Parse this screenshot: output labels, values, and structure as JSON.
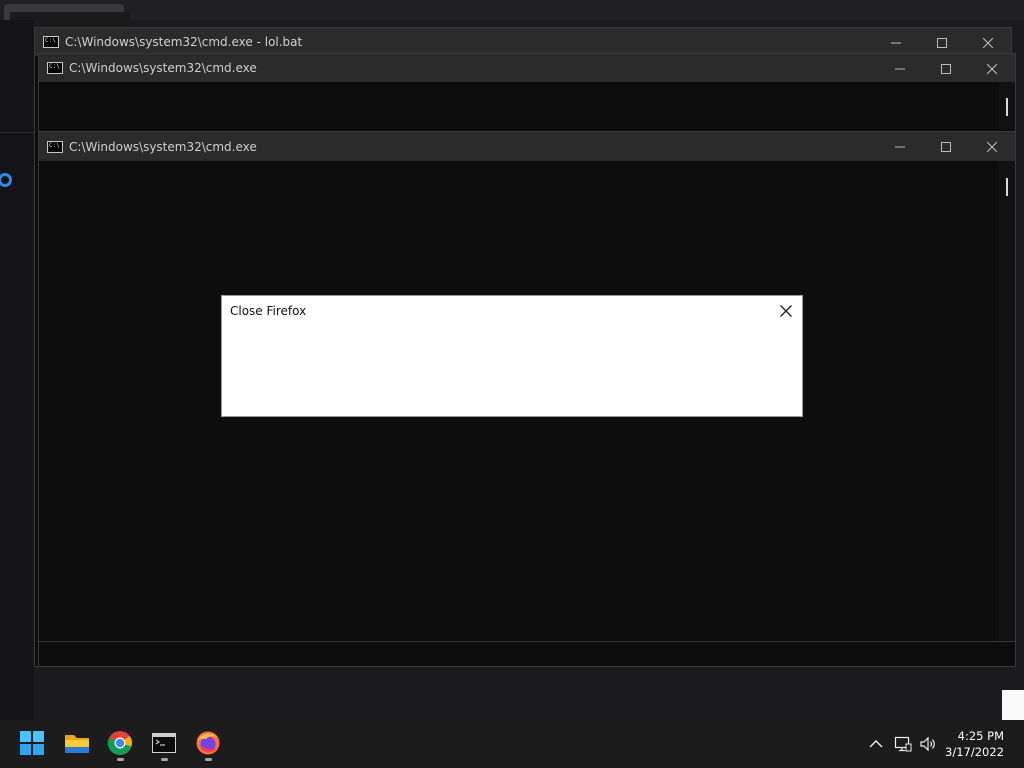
{
  "windows": {
    "back": {
      "title": "C:\\Windows\\system32\\cmd.exe - lol.bat",
      "icon": "cmd-icon"
    },
    "middle": {
      "title": "C:\\Windows\\system32\\cmd.exe",
      "icon": "cmd-icon"
    },
    "front": {
      "title": "C:\\Windows\\system32\\cmd.exe",
      "icon": "cmd-icon"
    }
  },
  "dialog": {
    "title": "Close Firefox"
  },
  "taskbar": {
    "apps": [
      {
        "name": "start",
        "icon": "windows-logo-icon"
      },
      {
        "name": "file-explorer",
        "icon": "folder-icon"
      },
      {
        "name": "chrome",
        "icon": "chrome-icon"
      },
      {
        "name": "command-prompt",
        "icon": "terminal-icon"
      },
      {
        "name": "firefox",
        "icon": "firefox-icon"
      }
    ],
    "tray": [
      "chevron-up-icon",
      "network-icon",
      "volume-icon"
    ],
    "time": "4:25 PM",
    "date": "3/17/2022"
  },
  "colors": {
    "accent": "#2f8be0",
    "console_bg": "#0c0c0c",
    "titlebar": "#2b2b2b"
  }
}
